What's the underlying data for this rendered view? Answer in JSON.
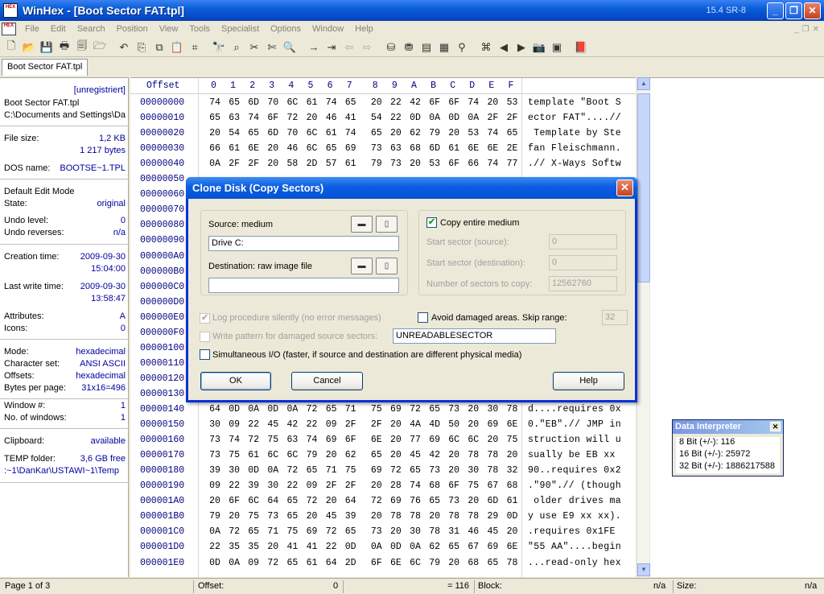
{
  "window": {
    "title": "WinHex - [Boot Sector FAT.tpl]",
    "version": "15.4 SR-8",
    "minimize": "_",
    "restore": "❐",
    "close": "✕",
    "app_icon_text": "HEX"
  },
  "menu": [
    "File",
    "Edit",
    "Search",
    "Position",
    "View",
    "Tools",
    "Specialist",
    "Options",
    "Window",
    "Help"
  ],
  "toolbar_icons": [
    "new-icon",
    "open-icon",
    "save-icon",
    "print-icon",
    "properties-icon",
    "open-folder-icon",
    "undo-icon",
    "copy-icon",
    "copy-block-icon",
    "paste-icon",
    "paste-zero-icon",
    "find-text-icon",
    "find-hex-icon",
    "replace-text-icon",
    "replace-hex-icon",
    "find-again-icon",
    "goto-offset-icon",
    "goto-sector-icon",
    "back-icon",
    "forward-icon",
    "open-disk-icon",
    "clone-disk-icon",
    "ram-icon",
    "calculator-icon",
    "search-icon",
    "table-icon",
    "prev-icon",
    "next-icon",
    "camera-icon",
    "grid-icon",
    "help-book-icon"
  ],
  "tab": {
    "label": "Boot Sector FAT.tpl"
  },
  "info": {
    "registered": "[unregistriert]",
    "filename": "Boot Sector FAT.tpl",
    "path": "C:\\Documents and Settings\\Da",
    "file_size_label": "File size:",
    "file_size_kb": "1,2 KB",
    "file_size_bytes": "1 217 bytes",
    "dos_name_label": "DOS name:",
    "dos_name": "BOOTSE~1.TPL",
    "edit_mode": "Default Edit Mode",
    "state_label": "State:",
    "state": "original",
    "undo_level_label": "Undo level:",
    "undo_level": "0",
    "undo_reverses_label": "Undo reverses:",
    "undo_reverses": "n/a",
    "creation_label": "Creation time:",
    "creation_date": "2009-09-30",
    "creation_time": "15:04:00",
    "lastwrite_label": "Last write time:",
    "lastwrite_date": "2009-09-30",
    "lastwrite_time": "13:58:47",
    "attributes_label": "Attributes:",
    "attributes": "A",
    "icons_label": "Icons:",
    "icons": "0",
    "mode_label": "Mode:",
    "mode": "hexadecimal",
    "charset_label": "Character set:",
    "charset": "ANSI ASCII",
    "offsets_label": "Offsets:",
    "offsets": "hexadecimal",
    "bpp_label": "Bytes per page:",
    "bpp": "31x16=496",
    "window_no_label": "Window #:",
    "window_no": "1",
    "num_windows_label": "No. of windows:",
    "num_windows": "1",
    "clipboard_label": "Clipboard:",
    "clipboard": "available",
    "temp_label": "TEMP folder:",
    "temp_free": "3,6 GB free",
    "temp_path": ":~1\\DanKar\\USTAWI~1\\Temp"
  },
  "hex": {
    "header_offset": "Offset",
    "columns": [
      "0",
      "1",
      "2",
      "3",
      "4",
      "5",
      "6",
      "7",
      "8",
      "9",
      "A",
      "B",
      "C",
      "D",
      "E",
      "F"
    ],
    "rows": [
      {
        "offset": "00000000",
        "bytes": [
          "74",
          "65",
          "6D",
          "70",
          "6C",
          "61",
          "74",
          "65",
          "20",
          "22",
          "42",
          "6F",
          "6F",
          "74",
          "20",
          "53"
        ],
        "text": "template \"Boot S"
      },
      {
        "offset": "00000010",
        "bytes": [
          "65",
          "63",
          "74",
          "6F",
          "72",
          "20",
          "46",
          "41",
          "54",
          "22",
          "0D",
          "0A",
          "0D",
          "0A",
          "2F",
          "2F"
        ],
        "text": "ector FAT\"....//"
      },
      {
        "offset": "00000020",
        "bytes": [
          "20",
          "54",
          "65",
          "6D",
          "70",
          "6C",
          "61",
          "74",
          "65",
          "20",
          "62",
          "79",
          "20",
          "53",
          "74",
          "65"
        ],
        "text": " Template by Ste"
      },
      {
        "offset": "00000030",
        "bytes": [
          "66",
          "61",
          "6E",
          "20",
          "46",
          "6C",
          "65",
          "69",
          "73",
          "63",
          "68",
          "6D",
          "61",
          "6E",
          "6E",
          "2E"
        ],
        "text": "fan Fleischmann."
      },
      {
        "offset": "00000040",
        "bytes": [
          "0A",
          "2F",
          "2F",
          "20",
          "58",
          "2D",
          "57",
          "61",
          "79",
          "73",
          "20",
          "53",
          "6F",
          "66",
          "74",
          "77"
        ],
        "text": ".// X-Ways Softw"
      },
      {
        "offset": "00000050",
        "bytes": [],
        "text": ""
      },
      {
        "offset": "00000060",
        "bytes": [],
        "text": ""
      },
      {
        "offset": "00000070",
        "bytes": [],
        "text": ""
      },
      {
        "offset": "00000080",
        "bytes": [],
        "text": ""
      },
      {
        "offset": "00000090",
        "bytes": [],
        "text": ""
      },
      {
        "offset": "000000A0",
        "bytes": [],
        "text": ""
      },
      {
        "offset": "000000B0",
        "bytes": [],
        "text": ""
      },
      {
        "offset": "000000C0",
        "bytes": [],
        "text": ""
      },
      {
        "offset": "000000D0",
        "bytes": [],
        "text": ""
      },
      {
        "offset": "000000E0",
        "bytes": [],
        "text": ""
      },
      {
        "offset": "000000F0",
        "bytes": [],
        "text": ""
      },
      {
        "offset": "00000100",
        "bytes": [],
        "text": ""
      },
      {
        "offset": "00000110",
        "bytes": [],
        "text": ""
      },
      {
        "offset": "00000120",
        "bytes": [],
        "text": ""
      },
      {
        "offset": "00000130",
        "bytes": [],
        "text": ""
      },
      {
        "offset": "00000140",
        "bytes": [
          "64",
          "0D",
          "0A",
          "0D",
          "0A",
          "72",
          "65",
          "71",
          "75",
          "69",
          "72",
          "65",
          "73",
          "20",
          "30",
          "78"
        ],
        "text": "d....requires 0x"
      },
      {
        "offset": "00000150",
        "bytes": [
          "30",
          "09",
          "22",
          "45",
          "42",
          "22",
          "09",
          "2F",
          "2F",
          "20",
          "4A",
          "4D",
          "50",
          "20",
          "69",
          "6E"
        ],
        "text": "0.\"EB\".// JMP in"
      },
      {
        "offset": "00000160",
        "bytes": [
          "73",
          "74",
          "72",
          "75",
          "63",
          "74",
          "69",
          "6F",
          "6E",
          "20",
          "77",
          "69",
          "6C",
          "6C",
          "20",
          "75"
        ],
        "text": "struction will u"
      },
      {
        "offset": "00000170",
        "bytes": [
          "73",
          "75",
          "61",
          "6C",
          "6C",
          "79",
          "20",
          "62",
          "65",
          "20",
          "45",
          "42",
          "20",
          "78",
          "78",
          "20"
        ],
        "text": "sually be EB xx "
      },
      {
        "offset": "00000180",
        "bytes": [
          "39",
          "30",
          "0D",
          "0A",
          "72",
          "65",
          "71",
          "75",
          "69",
          "72",
          "65",
          "73",
          "20",
          "30",
          "78",
          "32"
        ],
        "text": "90..requires 0x2"
      },
      {
        "offset": "00000190",
        "bytes": [
          "09",
          "22",
          "39",
          "30",
          "22",
          "09",
          "2F",
          "2F",
          "20",
          "28",
          "74",
          "68",
          "6F",
          "75",
          "67",
          "68"
        ],
        "text": ".\"90\".// (though"
      },
      {
        "offset": "000001A0",
        "bytes": [
          "20",
          "6F",
          "6C",
          "64",
          "65",
          "72",
          "20",
          "64",
          "72",
          "69",
          "76",
          "65",
          "73",
          "20",
          "6D",
          "61"
        ],
        "text": " older drives ma"
      },
      {
        "offset": "000001B0",
        "bytes": [
          "79",
          "20",
          "75",
          "73",
          "65",
          "20",
          "45",
          "39",
          "20",
          "78",
          "78",
          "20",
          "78",
          "78",
          "29",
          "0D"
        ],
        "text": "y use E9 xx xx)."
      },
      {
        "offset": "000001C0",
        "bytes": [
          "0A",
          "72",
          "65",
          "71",
          "75",
          "69",
          "72",
          "65",
          "73",
          "20",
          "30",
          "78",
          "31",
          "46",
          "45",
          "20"
        ],
        "text": ".requires 0x1FE "
      },
      {
        "offset": "000001D0",
        "bytes": [
          "22",
          "35",
          "35",
          "20",
          "41",
          "41",
          "22",
          "0D",
          "0A",
          "0D",
          "0A",
          "62",
          "65",
          "67",
          "69",
          "6E"
        ],
        "text": "\"55 AA\"....begin"
      },
      {
        "offset": "000001E0",
        "bytes": [
          "0D",
          "0A",
          "09",
          "72",
          "65",
          "61",
          "64",
          "2D",
          "6F",
          "6E",
          "6C",
          "79",
          "20",
          "68",
          "65",
          "78"
        ],
        "text": "...read-only hex"
      }
    ]
  },
  "scrollbar": {
    "up": "▲",
    "down": "▼"
  },
  "data_interpreter": {
    "title": "Data Interpreter",
    "close": "✕",
    "rows": [
      "8 Bit (+/-): 116",
      "16 Bit (+/-): 25972",
      "32 Bit (+/-): 1886217588"
    ]
  },
  "status": {
    "page": "Page 1 of 3",
    "offset_label": "Offset:",
    "offset_value": "0",
    "value": "= 116",
    "block_label": "Block:",
    "block_value": "n/a",
    "size_label": "Size:",
    "size_value": "n/a"
  },
  "dialog": {
    "title": "Clone Disk (Copy Sectors)",
    "close": "✕",
    "source_label": "Source: medium",
    "source_value": "Drive C:",
    "dest_label": "Destination: raw image file",
    "dest_value": "",
    "copy_entire_label": "Copy entire medium",
    "copy_entire_checked": "✔",
    "start_src_label": "Start sector (source):",
    "start_src_value": "0",
    "start_dst_label": "Start sector (destination):",
    "start_dst_value": "0",
    "num_sectors_label": "Number of sectors to copy:",
    "num_sectors_value": "12562760",
    "log_label": "Log procedure silently (no error messages)",
    "log_checked": "✔",
    "avoid_label": "Avoid damaged areas. Skip range:",
    "skip_range_value": "32",
    "write_pattern_label": "Write pattern for damaged source sectors:",
    "pattern_value": "UNREADABLESECTOR",
    "simul_label": "Simultaneous I/O (faster, if source and destination are different physical media)",
    "ok_label": "OK",
    "cancel_label": "Cancel",
    "help_label": "Help",
    "browse_glyph": "▬",
    "file_glyph": "▯"
  }
}
